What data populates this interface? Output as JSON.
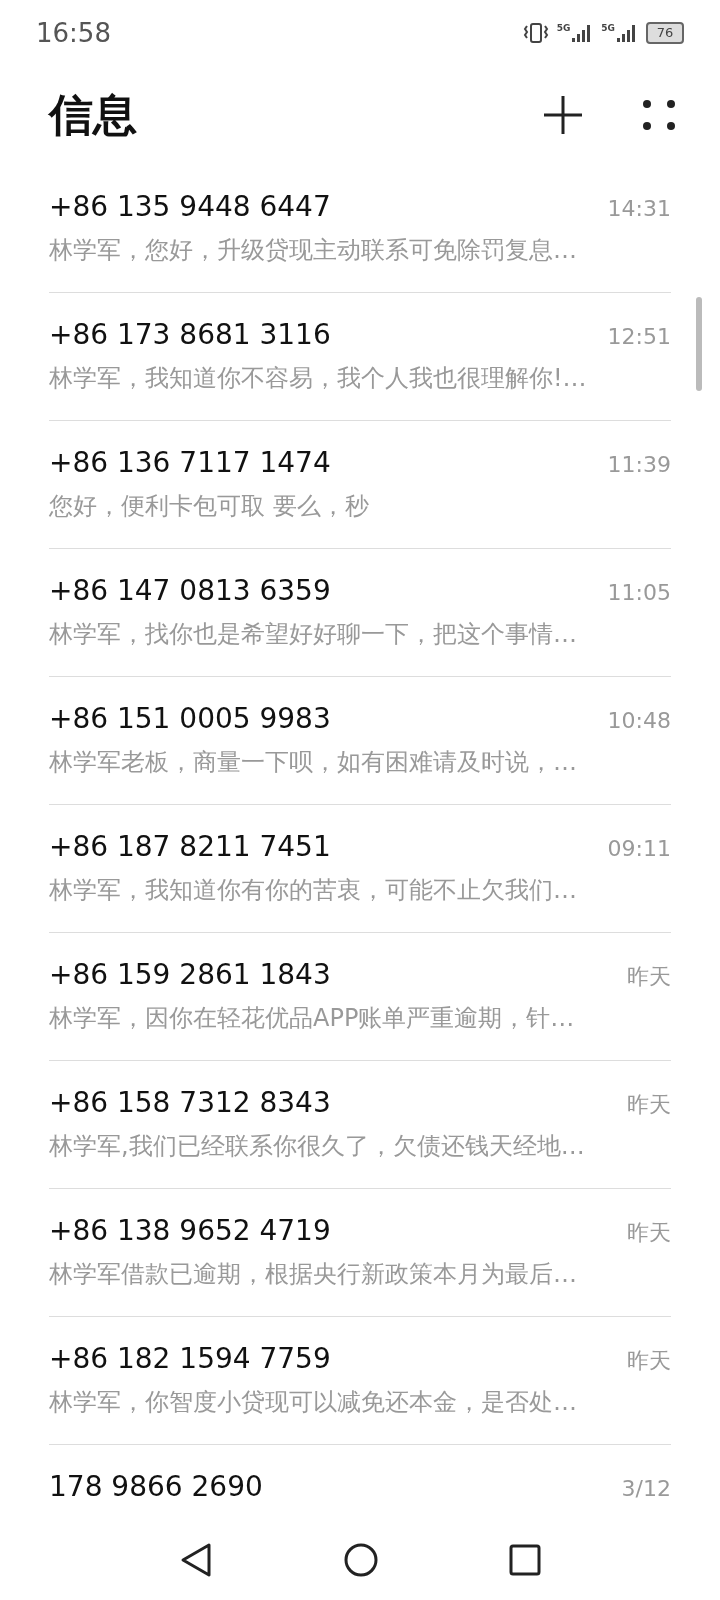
{
  "status_bar": {
    "time": "16:58",
    "sim_labels": [
      "5G",
      "5G"
    ],
    "battery": "76"
  },
  "header": {
    "title": "信息"
  },
  "conversations": [
    {
      "sender": "+86 135 9448 6447",
      "time": "14:31",
      "preview": "林学军，您好，升级贷现主动联系可免除罚复息…"
    },
    {
      "sender": "+86 173 8681 3116",
      "time": "12:51",
      "preview": "林学军，我知道你不容易，我个人我也很理解你!…"
    },
    {
      "sender": "+86 136 7117 1474",
      "time": "11:39",
      "preview": "您好，便利卡包可取 要么，秒"
    },
    {
      "sender": "+86 147 0813 6359",
      "time": "11:05",
      "preview": "林学军，找你也是希望好好聊一下，把这个事情…"
    },
    {
      "sender": "+86 151 0005 9983",
      "time": "10:48",
      "preview": "林学军老板，商量一下呗，如有困难请及时说，…"
    },
    {
      "sender": "+86 187 8211 7451",
      "time": "09:11",
      "preview": "林学军，我知道你有你的苦衷，可能不止欠我们…"
    },
    {
      "sender": "+86 159 2861 1843",
      "time": "昨天",
      "preview": "林学军，因你在轻花优品APP账单严重逾期，针…"
    },
    {
      "sender": "+86 158 7312 8343",
      "time": "昨天",
      "preview": "林学军,我们已经联系你很久了，欠债还钱天经地…"
    },
    {
      "sender": "+86 138 9652 4719",
      "time": "昨天",
      "preview": "林学军借款已逾期，根据央行新政策本月为最后…"
    },
    {
      "sender": "+86 182 1594 7759",
      "time": "昨天",
      "preview": "林学军，你智度小贷现可以减免还本金，是否处…"
    },
    {
      "sender": "178 9866 2690",
      "time": "3/12"
    }
  ]
}
